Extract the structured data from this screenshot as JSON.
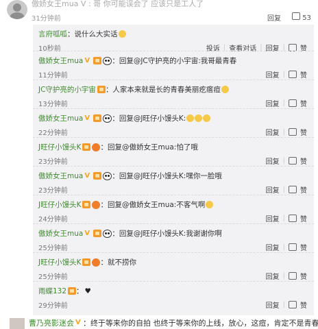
{
  "top": {
    "line_text": "傲娇女王mua V : 哥 你可能误会了 应该只是工人了",
    "name": "傲娇女王mua",
    "time": "31分钟前",
    "reply": "回复",
    "like_count": "53"
  },
  "comments": [
    {
      "name": "言府呱呱",
      "text": "：说什么大实话",
      "time": "10秒前",
      "actions": [
        "投诉",
        "查看对话",
        "回复",
        "赞"
      ]
    },
    {
      "name": "傲娇女王mua",
      "text": "：回复@JC守护亮的小宇宙:我哥最青春",
      "time": "11分钟前",
      "actions": [
        "回复",
        "赞"
      ]
    },
    {
      "name": "JC守护亮的小宇宙",
      "text": "：人家本来就是长的青春美丽疙瘩痘",
      "time": "13分钟前",
      "actions": [
        "回复",
        "赞"
      ]
    },
    {
      "name": "傲娇女王mua",
      "text": "：回复@J旺仔小馒头K:",
      "time": "22分钟前",
      "actions": [
        "回复",
        "赞"
      ]
    },
    {
      "name": "J旺仔小馒头K",
      "text": "：回复@傲娇女王mua:怕了哦",
      "time": "23分钟前",
      "actions": [
        "回复",
        "赞"
      ]
    },
    {
      "name": "傲娇女王mua",
      "text": "：回复@J旺仔小馒头K:嘿你一脸哦",
      "time": "23分钟前",
      "actions": [
        "回复",
        "赞"
      ]
    },
    {
      "name": "J旺仔小馒头K",
      "text": "：回复@傲娇女王mua:不客气啊",
      "time": "24分钟前",
      "actions": [
        "回复",
        "赞"
      ]
    },
    {
      "name": "傲娇女王mua",
      "text": "：回复@J旺仔小馒头K:我谢谢你啊",
      "time": "25分钟前",
      "actions": [
        "回复",
        "赞"
      ]
    },
    {
      "name": "J旺仔小馒头K",
      "text": "：就不捞你",
      "time": "25分钟前",
      "actions": [
        "回复",
        "赞"
      ]
    },
    {
      "name": "雨蝶132",
      "text": "：",
      "time": "29分钟前",
      "actions": [
        "回复",
        "赞"
      ]
    }
  ],
  "bottom": {
    "name": "曹乃亮影迷会",
    "text": "：终于等来你的自拍 也终于等来你的上线，放心，这痘，肯定不是青春痘"
  },
  "colors": {
    "name_green": "#3f8a2e",
    "panel_bg": "#f2f2f5",
    "vip_orange": "#f5a623"
  }
}
